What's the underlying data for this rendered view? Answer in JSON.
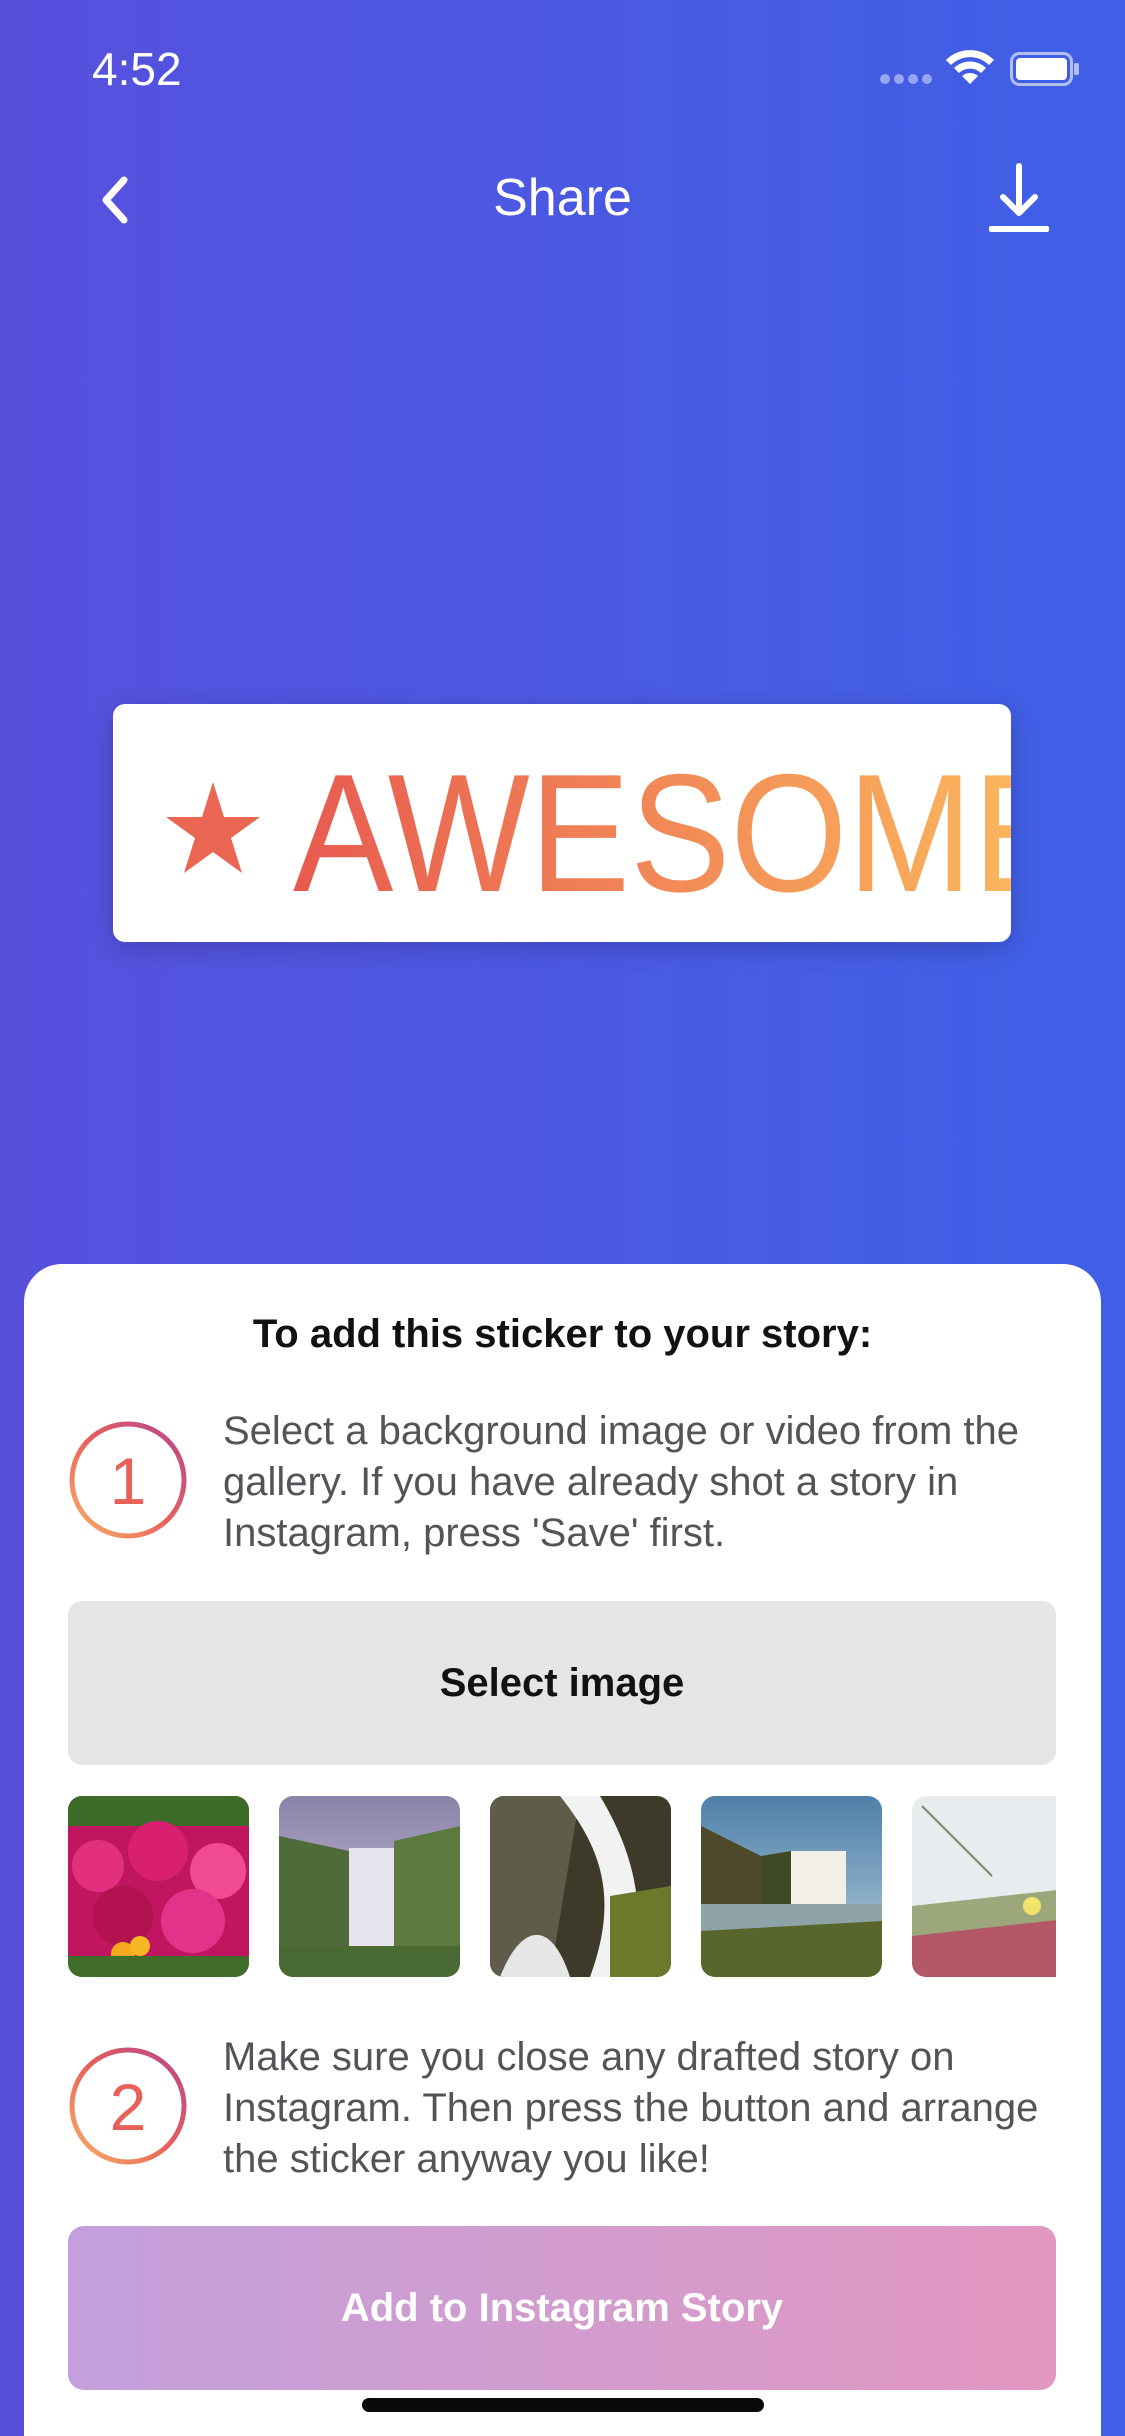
{
  "status_bar": {
    "time": "4:52"
  },
  "nav": {
    "title": "Share"
  },
  "sticker": {
    "text": "AWESOME",
    "gradient_start": "#e85a50",
    "gradient_end": "#fcbd5e"
  },
  "sheet": {
    "title": "To add this sticker to your story:",
    "step1": {
      "number": "1",
      "text": "Select a background image or video from the gallery. If you have already shot a story in Instagram, press  'Save' first."
    },
    "select_button": "Select image",
    "step2": {
      "number": "2",
      "text": "Make sure you close any drafted story on Instagram. Then press the button and arrange the sticker anyway you like!"
    },
    "add_button": "Add to Instagram Story"
  },
  "colors": {
    "background_start": "#5650dd",
    "background_end": "#3f5fe6",
    "badge_gradient_start": "#f7b267",
    "badge_gradient_end": "#b5478f"
  },
  "gallery_thumbnails": [
    "pink-flowers-photo",
    "waterfall-cliff-photo",
    "waterfall-rocks-photo",
    "waterfall-river-photo",
    "beach-plants-photo"
  ]
}
